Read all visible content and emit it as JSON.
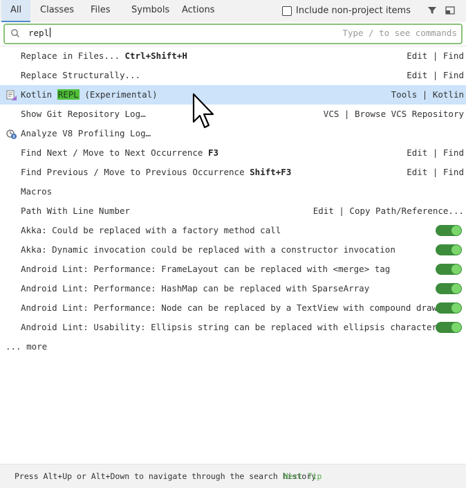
{
  "tabs": [
    {
      "label": "All",
      "active": true
    },
    {
      "label": "Classes"
    },
    {
      "label": "Files"
    },
    {
      "label": "Symbols"
    },
    {
      "label": "Actions"
    }
  ],
  "options": {
    "include_label": "Include non-project items",
    "include_checked": false,
    "filter_icon": "filter-icon",
    "pin_icon": "pin-window-icon"
  },
  "search": {
    "value": "repl",
    "hint": "Type / to see commands",
    "icon": "search-icon"
  },
  "results": [
    {
      "name": "Replace in Files...",
      "shortcut": "Ctrl+Shift+H",
      "right": "Edit | Find"
    },
    {
      "name": "Replace Structurally...",
      "right": "Edit | Find"
    },
    {
      "name_pre": "Kotlin ",
      "name_hl": "REPL",
      "name_post": " (Experimental)",
      "right": "Tools | Kotlin",
      "selected": true,
      "icon": "kotlin-repl-icon"
    },
    {
      "name": "Show Git Repository Log…",
      "right": "VCS | Browse VCS Repository"
    },
    {
      "name": "Analyze V8 Profiling Log…",
      "icon": "v8-profiling-icon"
    },
    {
      "name": "Find Next / Move to Next Occurrence",
      "shortcut": "F3",
      "right": "Edit | Find"
    },
    {
      "name": "Find Previous / Move to Previous Occurrence",
      "shortcut": "Shift+F3",
      "right": "Edit | Find"
    },
    {
      "name": "Macros"
    },
    {
      "name": "Path With Line Number",
      "right": "Edit | Copy Path/Reference..."
    },
    {
      "name": "Akka: Could be replaced with a factory method call",
      "toggle": true
    },
    {
      "name": "Akka: Dynamic invocation could be replaced with a constructor invocation",
      "toggle": true
    },
    {
      "name": "Android Lint: Performance: FrameLayout can be replaced with <merge> tag",
      "toggle": true
    },
    {
      "name": "Android Lint: Performance: HashMap can be replaced with SparseArray",
      "toggle": true
    },
    {
      "name": "Android Lint: Performance: Node can be replaced by a TextView with compound drawa...",
      "toggle": true
    },
    {
      "name": "Android Lint: Usability: Ellipsis string can be replaced with ellipsis character",
      "toggle": true
    }
  ],
  "more_label": "... more",
  "footer": {
    "tip": "Press Alt+Up or Alt+Down to navigate through the search history",
    "next_tip": "Next Tip"
  },
  "colors": {
    "selection": "#cce3fa",
    "match_highlight": "#4fbf3a",
    "toggle_on": "#3c8c3c",
    "search_border": "#8ac17a",
    "next_tip": "#57a84f"
  }
}
